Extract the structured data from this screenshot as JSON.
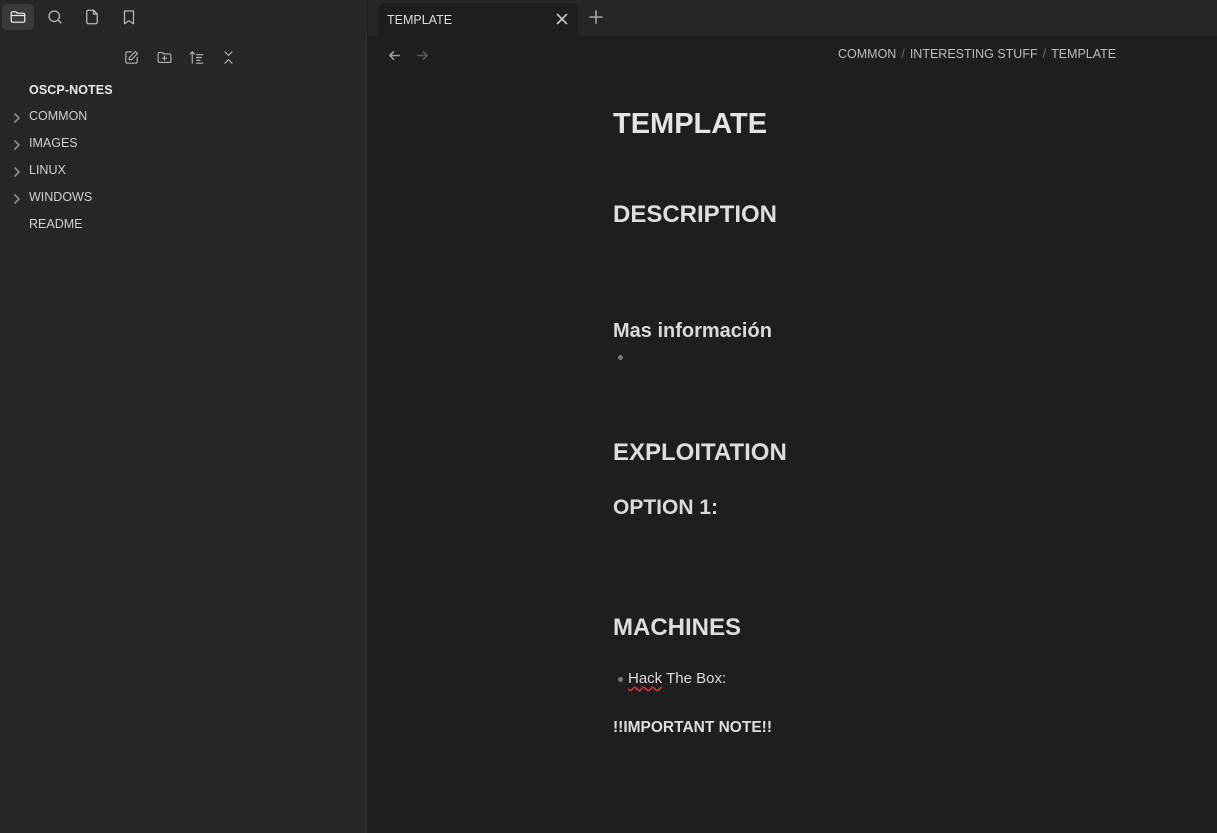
{
  "ribbon": {
    "icons": [
      "folder-icon",
      "search-icon",
      "file-icon",
      "bookmark-icon"
    ]
  },
  "file_explorer": {
    "actions": [
      "new-note-icon",
      "new-folder-icon",
      "sort-icon",
      "collapse-all-icon"
    ],
    "vault_name": "OSCP-NOTES",
    "items": [
      {
        "label": "COMMON",
        "type": "folder"
      },
      {
        "label": "IMAGES",
        "type": "folder"
      },
      {
        "label": "LINUX",
        "type": "folder"
      },
      {
        "label": "WINDOWS",
        "type": "folder"
      },
      {
        "label": "README",
        "type": "file"
      }
    ]
  },
  "tabs": {
    "active_title": "TEMPLATE"
  },
  "breadcrumb": [
    "COMMON",
    "INTERESTING STUFF",
    "TEMPLATE"
  ],
  "note": {
    "title": "TEMPLATE",
    "description_heading": "DESCRIPTION",
    "more_info_heading": "Mas información",
    "exploitation_heading": "EXPLOITATION",
    "option_heading": "OPTION 1:",
    "machines_heading": "MACHINES",
    "machines_item_word1": "Hack",
    "machines_item_rest": " The Box:",
    "important_note": "!!IMPORTANT NOTE!!"
  },
  "colors": {
    "background": "#1e1e1e",
    "sidebar": "#262626",
    "text": "#dadada"
  }
}
